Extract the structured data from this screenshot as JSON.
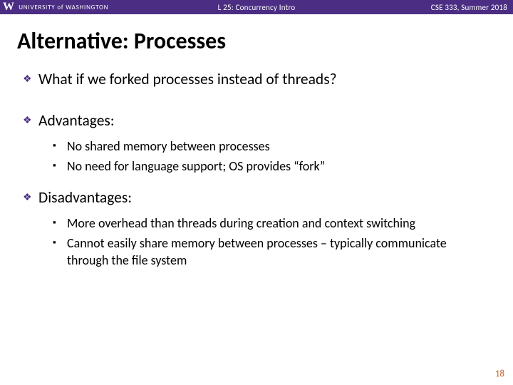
{
  "header": {
    "logo_letter": "W",
    "university": "UNIVERSITY of WASHINGTON",
    "center": "L 25: Concurrency Intro",
    "right": "CSE 333, Summer 2018"
  },
  "title": "Alternative: Processes",
  "bullets": {
    "b1": "What if we forked processes instead of threads?",
    "b2": "Advantages:",
    "b2_sub": {
      "s1": "No shared memory between processes",
      "s2": "No need for language support; OS provides “fork”"
    },
    "b3": "Disadvantages:",
    "b3_sub": {
      "s1": "More overhead than threads during creation and context switching",
      "s2": "Cannot easily share memory between processes – typically communicate through the file system"
    }
  },
  "page_number": "18",
  "glyphs": {
    "diamond": "❖",
    "square": "▪"
  }
}
